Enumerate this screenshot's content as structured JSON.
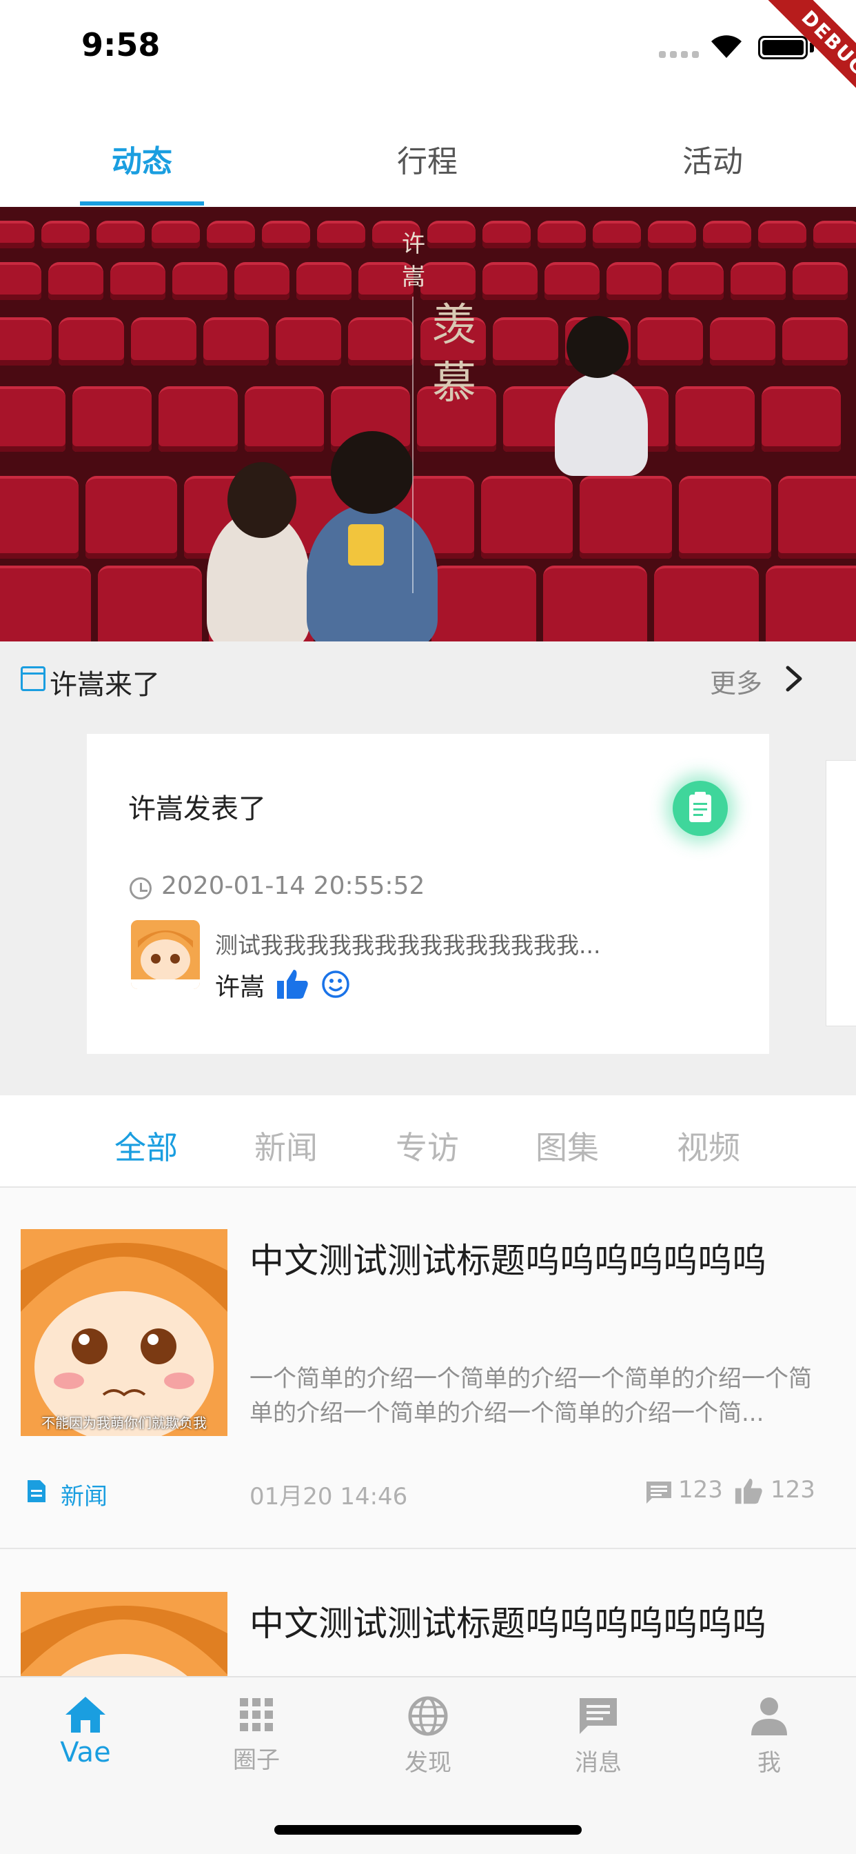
{
  "status": {
    "time": "9:58",
    "debug_label": "DEBUG"
  },
  "top_tabs": [
    {
      "label": "动态"
    },
    {
      "label": "行程"
    },
    {
      "label": "活动"
    }
  ],
  "banner": {
    "artist": "许嵩",
    "song": "羡慕"
  },
  "section": {
    "title": "许嵩来了",
    "more": "更多"
  },
  "card": {
    "title": "许嵩发表了",
    "time": "2020-01-14 20:55:52",
    "text": "测试我我我我我我我我我我我我我我...",
    "user": "许嵩"
  },
  "category_tabs": [
    {
      "label": "全部"
    },
    {
      "label": "新闻"
    },
    {
      "label": "专访"
    },
    {
      "label": "图集"
    },
    {
      "label": "视频"
    }
  ],
  "thumb_caption": "不能因为我萌你们就欺负我",
  "list": [
    {
      "title": "中文测试测试标题呜呜呜呜呜呜呜",
      "desc": "一个简单的介绍一个简单的介绍一个简单的介绍一个简单的介绍一个简单的介绍一个简单的介绍一个简...",
      "category": "新闻",
      "date": "01月20 14:46",
      "comments": "123",
      "likes": "123"
    },
    {
      "title": "中文测试测试标题呜呜呜呜呜呜呜"
    }
  ],
  "bottom_nav": [
    {
      "label": "Vae",
      "icon": "home-icon"
    },
    {
      "label": "圈子",
      "icon": "grid-icon"
    },
    {
      "label": "发现",
      "icon": "globe-icon"
    },
    {
      "label": "消息",
      "icon": "message-icon"
    },
    {
      "label": "我",
      "icon": "person-icon"
    }
  ],
  "colors": {
    "accent": "#1a9ee0",
    "badge": "#3fd69b",
    "banner_seat": "#a8142a"
  }
}
